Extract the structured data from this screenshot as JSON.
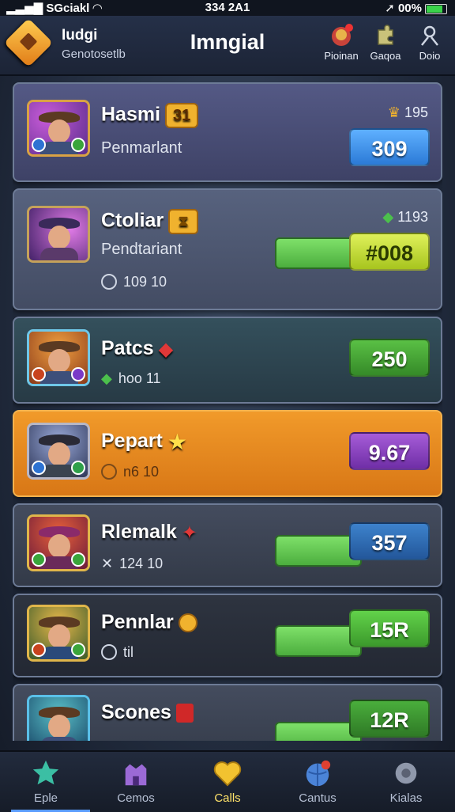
{
  "status_bar": {
    "carrier": "SGciakl",
    "time": "334 2A1",
    "battery": "00%"
  },
  "header": {
    "app_name": "Iudgi",
    "app_subtitle": "Genotosetlb",
    "title": "Imngial",
    "buttons": [
      {
        "label": "Pioinan",
        "icon": "gift-icon"
      },
      {
        "label": "Gaqoa",
        "icon": "puzzle-icon"
      },
      {
        "label": "Doio",
        "icon": "profile-icon"
      }
    ]
  },
  "players": [
    {
      "name": "Hasmi",
      "tag": "31",
      "subtitle": "Penmarlant",
      "meta": "",
      "rank": "195",
      "score": "309",
      "score_color": "#3a8ee8",
      "card_color": "#474a72",
      "progress": null
    },
    {
      "name": "Ctoliar",
      "tag": "",
      "subtitle": "Pendtariant",
      "meta": "109 10",
      "rank": "1193",
      "score": "#008",
      "score_color": "#b6d62a",
      "card_color": "#48526d",
      "progress": 1.0
    },
    {
      "name": "Patcs",
      "tag": "",
      "subtitle": "",
      "meta": "hoo 11",
      "rank": "",
      "score": "250",
      "score_color": "#46a734",
      "card_color": "#2d3f4c",
      "progress": null
    },
    {
      "name": "Pepart",
      "tag": "",
      "subtitle": "",
      "meta": "n6 10",
      "rank": "",
      "score": "9.67",
      "score_color": "#8d3ec4",
      "card_color": "#e0861c",
      "progress": null
    },
    {
      "name": "Rlemalk",
      "tag": "",
      "subtitle": "",
      "meta": "124 10",
      "rank": "",
      "score": "357",
      "score_color": "#2b6eb8",
      "card_color": "#39404f",
      "progress": 0.82
    },
    {
      "name": "Pennlar",
      "tag": "",
      "subtitle": "",
      "meta": "til",
      "rank": "",
      "score": "15R",
      "score_color": "#46b23a",
      "card_color": "#2a2f3b",
      "progress": 1.0
    },
    {
      "name": "Scones",
      "tag": "",
      "subtitle": "",
      "meta": "",
      "rank": "",
      "score": "12R",
      "score_color": "#3e9a33",
      "card_color": "#39404f",
      "progress": 1.0
    }
  ],
  "tabs": [
    {
      "label": "Eple",
      "icon": "star-icon",
      "color": "#3bbfa4"
    },
    {
      "label": "Cemos",
      "icon": "castle-icon",
      "color": "#9b6ad6"
    },
    {
      "label": "Calls",
      "icon": "heart-icon",
      "color": "#f2c230",
      "active": true
    },
    {
      "label": "Cantus",
      "icon": "globe-icon",
      "color": "#4b84d8"
    },
    {
      "label": "Kialas",
      "icon": "gear-icon",
      "color": "#8f98ab"
    }
  ]
}
